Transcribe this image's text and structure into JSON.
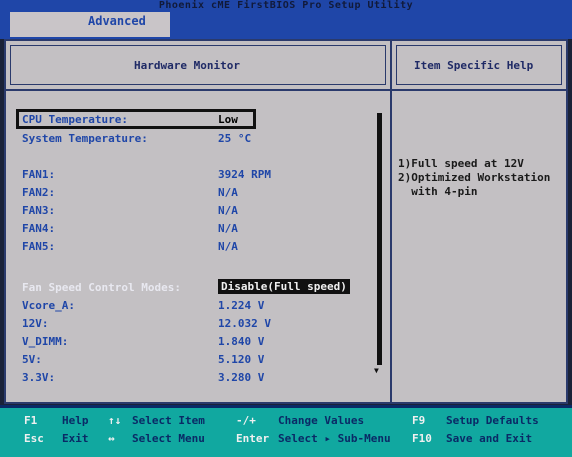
{
  "app": {
    "title": "Phoenix cME FirstBIOS Pro Setup Utility"
  },
  "tabs": {
    "active": "Advanced"
  },
  "panel": {
    "left_title": "Hardware Monitor",
    "right_title": "Item Specific Help"
  },
  "monitor": [
    {
      "label": "CPU  Temperature:",
      "value": "Low"
    },
    {
      "label": "System Temperature:",
      "value": "25 °C"
    },
    {
      "label": "FAN1:",
      "value": "3924 RPM"
    },
    {
      "label": "FAN2:",
      "value": "N/A"
    },
    {
      "label": "FAN3:",
      "value": "N/A"
    },
    {
      "label": "FAN4:",
      "value": "N/A"
    },
    {
      "label": "FAN5:",
      "value": "N/A"
    },
    {
      "label": "Fan Speed Control Modes:",
      "value": "Disable(Full speed)"
    },
    {
      "label": "Vcore_A:",
      "value": "1.224 V"
    },
    {
      "label": "12V:",
      "value": "12.032 V"
    },
    {
      "label": "V_DIMM:",
      "value": "1.840 V"
    },
    {
      "label": "5V:",
      "value": "5.120 V"
    },
    {
      "label": "3.3V:",
      "value": "3.280 V"
    }
  ],
  "help": {
    "line1": "1)Full speed at 12V",
    "line2": "2)Optimized Workstation",
    "line3": "  with 4-pin"
  },
  "footer": {
    "f1_key": "F1",
    "f1_desc": "Help",
    "updown_key": "↑↓",
    "updown_desc": "Select Item",
    "pm_key": "-/+",
    "pm_desc": "Change Values",
    "f9_key": "F9",
    "f9_desc": "Setup Defaults",
    "esc_key": "Esc",
    "esc_desc": "Exit",
    "lr_key": "↔",
    "lr_desc": "Select Menu",
    "enter_key": "Enter",
    "enter_desc": "Select ▸ Sub-Menu",
    "f10_key": "F10",
    "f10_desc": "Save and Exit"
  }
}
